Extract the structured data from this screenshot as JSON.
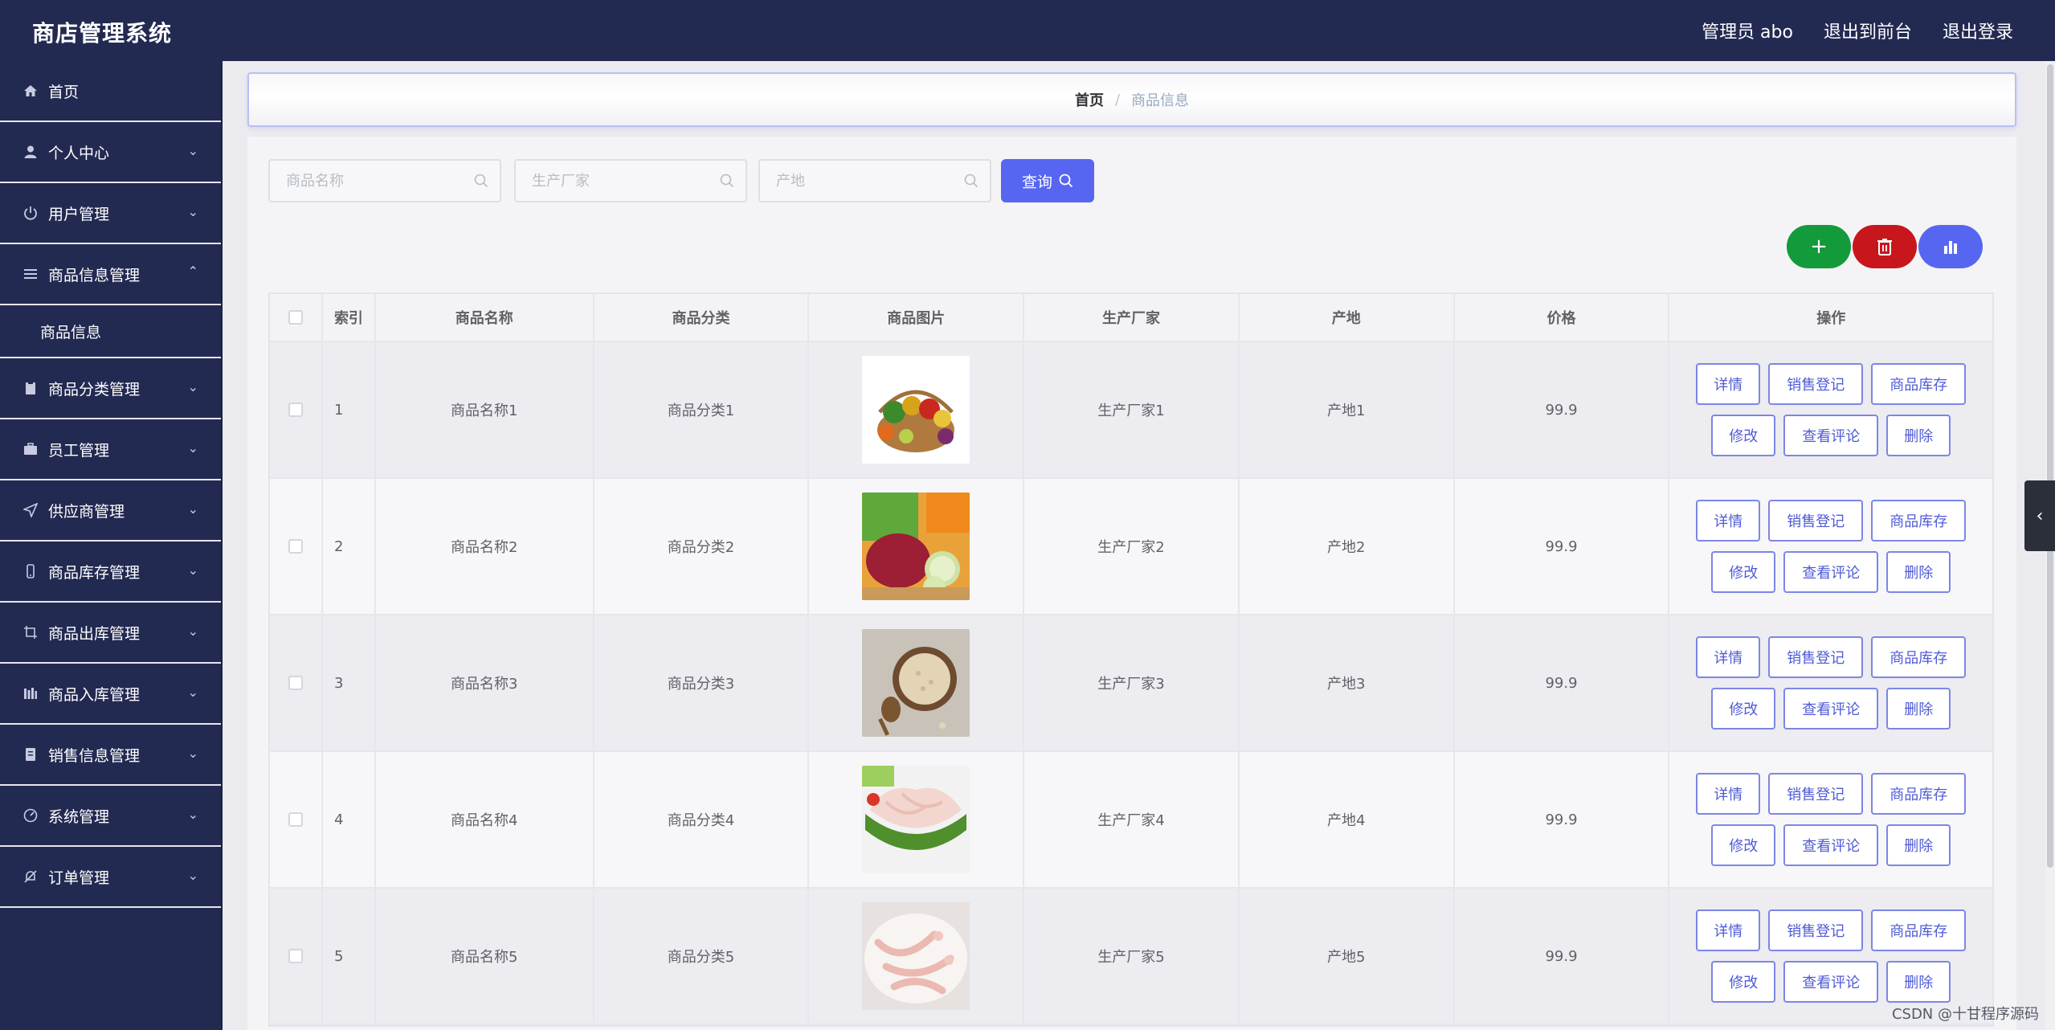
{
  "app": {
    "title": "商店管理系统"
  },
  "header": {
    "user_label": "管理员 abo",
    "front_link": "退出到前台",
    "logout_link": "退出登录"
  },
  "sidebar": {
    "items": [
      {
        "label": "首页",
        "icon": "home-icon"
      },
      {
        "label": "个人中心",
        "icon": "user-icon"
      },
      {
        "label": "用户管理",
        "icon": "power-icon"
      },
      {
        "label": "商品信息管理",
        "icon": "menu-icon"
      },
      {
        "label": "商品分类管理",
        "icon": "clipboard-icon"
      },
      {
        "label": "员工管理",
        "icon": "briefcase-icon"
      },
      {
        "label": "供应商管理",
        "icon": "send-icon"
      },
      {
        "label": "商品库存管理",
        "icon": "phone-icon"
      },
      {
        "label": "商品出库管理",
        "icon": "crop-icon"
      },
      {
        "label": "商品入库管理",
        "icon": "bars-icon"
      },
      {
        "label": "销售信息管理",
        "icon": "document-icon"
      },
      {
        "label": "系统管理",
        "icon": "gauge-icon"
      },
      {
        "label": "订单管理",
        "icon": "bell-off-icon"
      }
    ],
    "submenu": {
      "label": "商品信息"
    }
  },
  "breadcrumb": {
    "home": "首页",
    "separator": "/",
    "current": "商品信息"
  },
  "search": {
    "name_placeholder": "商品名称",
    "maker_placeholder": "生产厂家",
    "origin_placeholder": "产地",
    "query_label": "查询"
  },
  "actions": {
    "add_icon": "+",
    "colors": {
      "add": "#139a3b",
      "delete": "#c8161d",
      "chart": "#5766f0"
    }
  },
  "table": {
    "headers": [
      "索引",
      "商品名称",
      "商品分类",
      "商品图片",
      "生产厂家",
      "产地",
      "价格",
      "操作"
    ],
    "rows": [
      {
        "index": "1",
        "name": "商品名称1",
        "category": "商品分类1",
        "maker": "生产厂家1",
        "origin": "产地1",
        "price": "99.9"
      },
      {
        "index": "2",
        "name": "商品名称2",
        "category": "商品分类2",
        "maker": "生产厂家2",
        "origin": "产地2",
        "price": "99.9"
      },
      {
        "index": "3",
        "name": "商品名称3",
        "category": "商品分类3",
        "maker": "生产厂家3",
        "origin": "产地3",
        "price": "99.9"
      },
      {
        "index": "4",
        "name": "商品名称4",
        "category": "商品分类4",
        "maker": "生产厂家4",
        "origin": "产地4",
        "price": "99.9"
      },
      {
        "index": "5",
        "name": "商品名称5",
        "category": "商品分类5",
        "maker": "生产厂家5",
        "origin": "产地5",
        "price": "99.9"
      }
    ],
    "row_buttons": {
      "detail": "详情",
      "sale": "销售登记",
      "stock": "商品库存",
      "edit": "修改",
      "comments": "查看评论",
      "delete": "删除"
    }
  },
  "watermark": "CSDN @十甘程序源码",
  "theme": {
    "sidebar_bg": "#232a52",
    "accent": "#5766f0"
  }
}
